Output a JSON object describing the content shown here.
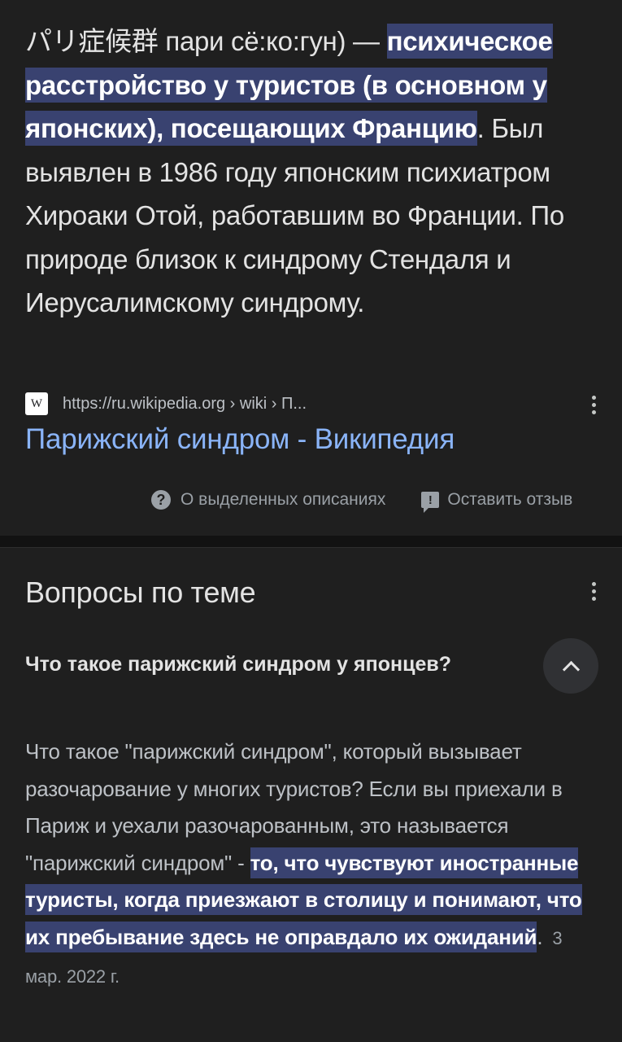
{
  "snippet": {
    "text_before": "パリ症候群 пари сё:ко:гун) — ",
    "highlight": "психическое расстройство у туристов (в основном у японских), посещающих Францию",
    "text_after": ". Был выявлен в 1986 году японским психиатром Хироаки Отой, работавшим во Франции. По природе близок к синдрому Стендаля и Иерусалимскому синдрому."
  },
  "source": {
    "favicon_letter": "W",
    "url": "https://ru.wikipedia.org › wiki › П...",
    "title": "Парижский синдром - Википедия"
  },
  "footer": {
    "about_label": "О выделенных описаниях",
    "feedback_label": "Оставить отзыв"
  },
  "related": {
    "title": "Вопросы по теме",
    "question": "Что такое парижский синдром у японцев?",
    "answer_before": "Что такое \"парижский синдром\", который вызывает разочарование у многих туристов? Если вы приехали в Париж и уехали разочарованным, это называется \"парижский синдром\" - ",
    "answer_highlight": "то, что чувствуют иностранные туристы, когда приезжают в столицу и понимают, что их пребывание здесь не оправдало их ожиданий",
    "answer_after": ".",
    "date": "3 мар. 2022 г."
  },
  "colors": {
    "background": "#1f1f1f",
    "highlight": "#394270",
    "link": "#8ab4f8"
  },
  "icons": [
    "wikipedia-favicon-icon",
    "more-vert-icon",
    "help-circle-icon",
    "feedback-icon",
    "chevron-up-icon"
  ]
}
